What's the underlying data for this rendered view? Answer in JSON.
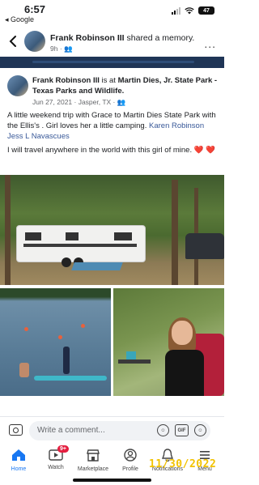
{
  "status": {
    "time": "6:57",
    "back_app": "◂ Google",
    "battery": "47"
  },
  "header": {
    "name": "Frank Robinson III",
    "action": " shared a memory.",
    "age": "9h · ",
    "more": "..."
  },
  "post": {
    "author": "Frank Robinson III",
    "is_at": " is at ",
    "place": "Martin Dies, Jr. State Park - Texas Parks and Wildlife.",
    "date": "Jun 27, 2021 · Jasper, TX · ",
    "body_start": "A little weekend trip with Grace to Martin Dies State Park with the Ellis's . Girl loves her a little camping. ",
    "tag1": "Karen Robinson",
    "tag_sep": " ",
    "tag2": "Jess L Navascues",
    "body_end": "I will travel anywhere in the world with this girl of mine. ",
    "hearts": "❤️ ❤️"
  },
  "comment": {
    "placeholder": "Write a comment...",
    "gif_label": "GIF"
  },
  "tabs": [
    {
      "label": "Home",
      "icon": "home-icon"
    },
    {
      "label": "Watch",
      "icon": "watch-icon",
      "badge": "9+"
    },
    {
      "label": "Marketplace",
      "icon": "marketplace-icon"
    },
    {
      "label": "Profile",
      "icon": "profile-icon"
    },
    {
      "label": "Notifications",
      "icon": "bell-icon"
    },
    {
      "label": "Menu",
      "icon": "menu-icon"
    }
  ],
  "date_stamp": "11/30/2022",
  "colors": {
    "accent": "#1877f2",
    "tag_link": "#385898",
    "badge": "#e41e3f",
    "stamp": "#f2c200"
  }
}
